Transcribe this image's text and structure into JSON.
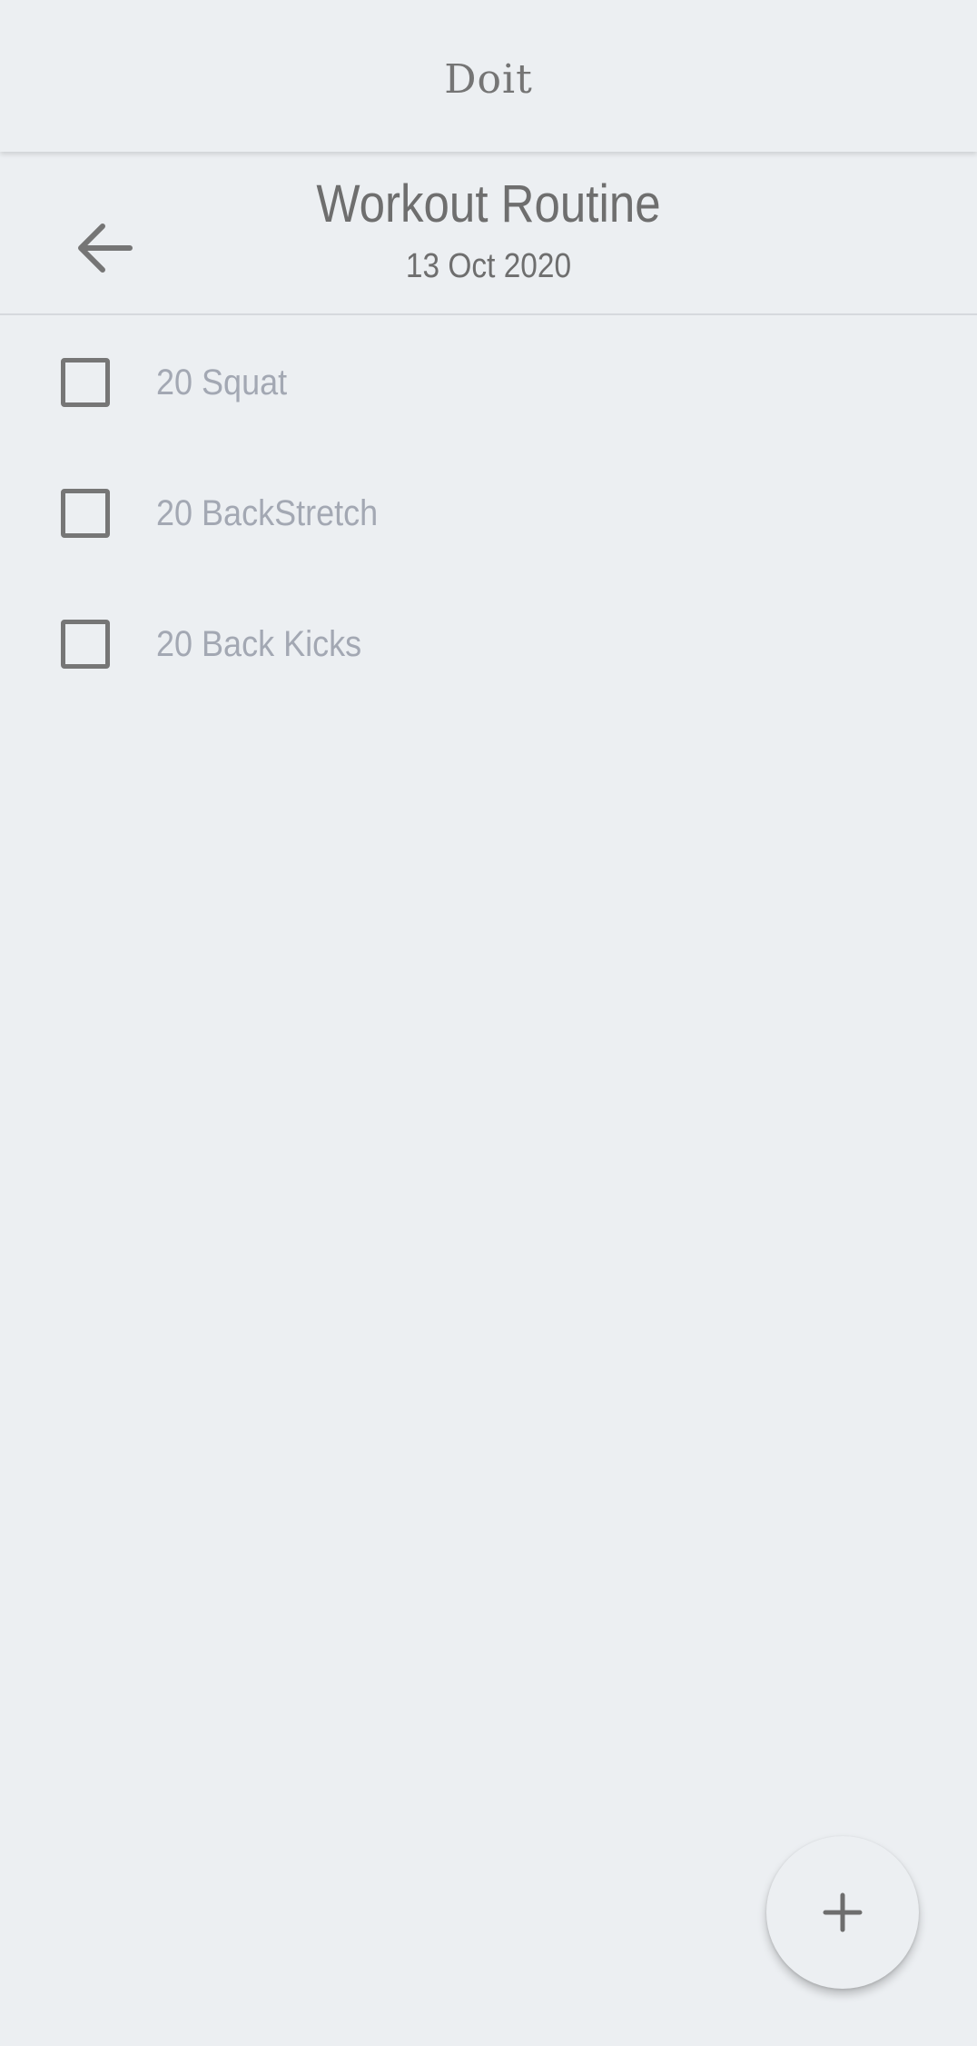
{
  "app": {
    "title": "Doit"
  },
  "header": {
    "back_icon": "arrow-left-icon",
    "title": "Workout Routine",
    "date": "13 Oct 2020"
  },
  "tasks": [
    {
      "label": "20 Squat",
      "checked": false
    },
    {
      "label": "20 BackStretch",
      "checked": false
    },
    {
      "label": "20 Back Kicks",
      "checked": false
    }
  ],
  "fab": {
    "icon": "plus-icon"
  },
  "colors": {
    "background": "#ECEFF2",
    "text_primary": "#6E6E6E",
    "text_task": "#A3A8B3",
    "checkbox_border": "#767676"
  }
}
